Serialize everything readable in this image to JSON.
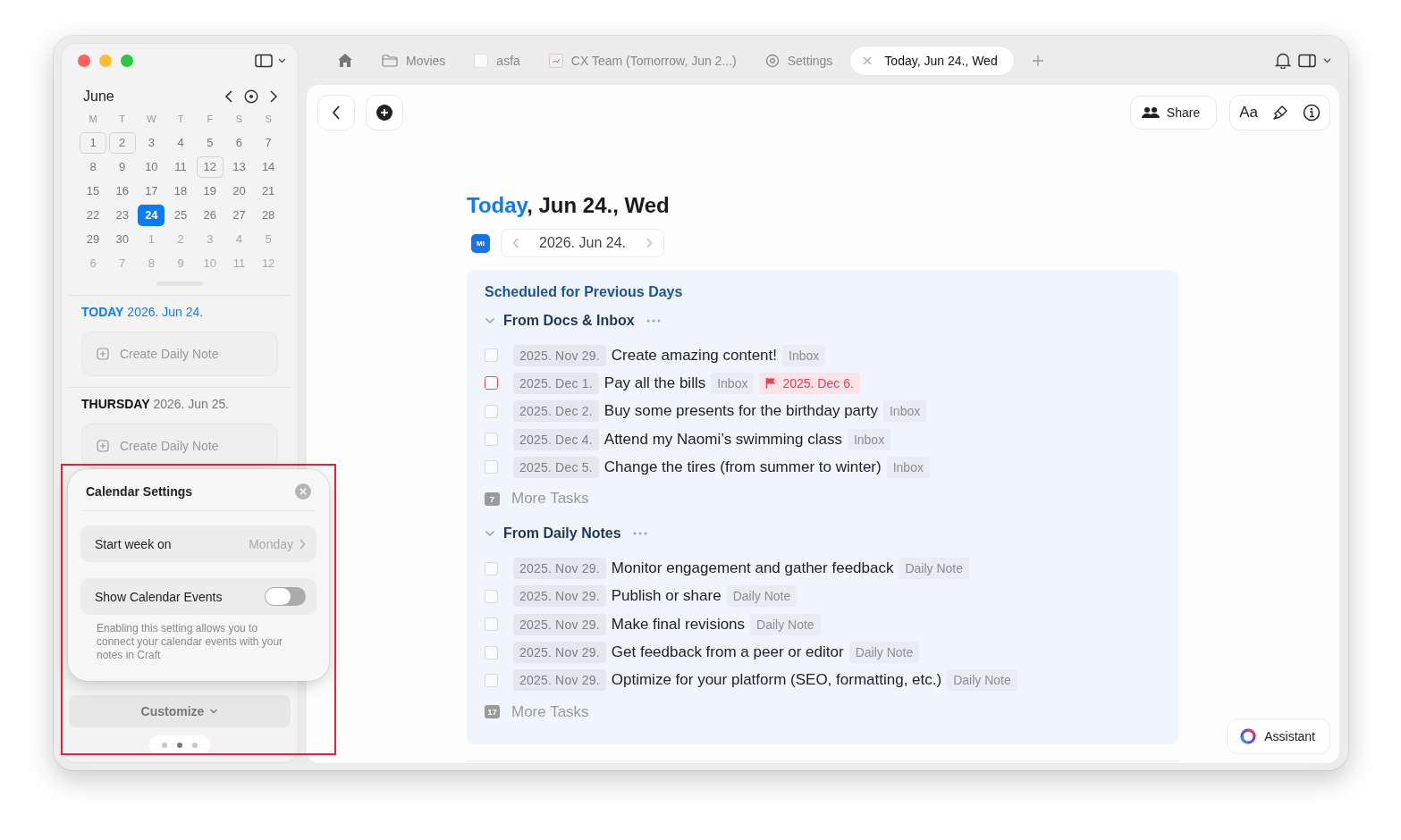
{
  "sidebar": {
    "month": "June",
    "weekdays": [
      "M",
      "T",
      "W",
      "T",
      "F",
      "S",
      "S"
    ],
    "weeks": [
      [
        {
          "label": "1",
          "marked": true,
          "selected": false,
          "other_month": false
        },
        {
          "label": "2",
          "marked": true,
          "selected": false,
          "other_month": false
        },
        {
          "label": "3",
          "marked": false,
          "selected": false,
          "other_month": false
        },
        {
          "label": "4",
          "marked": false,
          "selected": false,
          "other_month": false
        },
        {
          "label": "5",
          "marked": false,
          "selected": false,
          "other_month": false
        },
        {
          "label": "6",
          "marked": false,
          "selected": false,
          "other_month": false
        },
        {
          "label": "7",
          "marked": false,
          "selected": false,
          "other_month": false
        }
      ],
      [
        {
          "label": "8",
          "marked": false,
          "selected": false,
          "other_month": false
        },
        {
          "label": "9",
          "marked": false,
          "selected": false,
          "other_month": false
        },
        {
          "label": "10",
          "marked": false,
          "selected": false,
          "other_month": false
        },
        {
          "label": "11",
          "marked": false,
          "selected": false,
          "other_month": false
        },
        {
          "label": "12",
          "marked": true,
          "selected": false,
          "other_month": false
        },
        {
          "label": "13",
          "marked": false,
          "selected": false,
          "other_month": false
        },
        {
          "label": "14",
          "marked": false,
          "selected": false,
          "other_month": false
        }
      ],
      [
        {
          "label": "15",
          "marked": false,
          "selected": false,
          "other_month": false
        },
        {
          "label": "16",
          "marked": false,
          "selected": false,
          "other_month": false
        },
        {
          "label": "17",
          "marked": false,
          "selected": false,
          "other_month": false
        },
        {
          "label": "18",
          "marked": false,
          "selected": false,
          "other_month": false
        },
        {
          "label": "19",
          "marked": false,
          "selected": false,
          "other_month": false
        },
        {
          "label": "20",
          "marked": false,
          "selected": false,
          "other_month": false
        },
        {
          "label": "21",
          "marked": false,
          "selected": false,
          "other_month": false
        }
      ],
      [
        {
          "label": "22",
          "marked": false,
          "selected": false,
          "other_month": false
        },
        {
          "label": "23",
          "marked": false,
          "selected": false,
          "other_month": false
        },
        {
          "label": "24",
          "marked": false,
          "selected": true,
          "other_month": false
        },
        {
          "label": "25",
          "marked": false,
          "selected": false,
          "other_month": false
        },
        {
          "label": "26",
          "marked": false,
          "selected": false,
          "other_month": false
        },
        {
          "label": "27",
          "marked": false,
          "selected": false,
          "other_month": false
        },
        {
          "label": "28",
          "marked": false,
          "selected": false,
          "other_month": false
        }
      ],
      [
        {
          "label": "29",
          "marked": false,
          "selected": false,
          "other_month": false
        },
        {
          "label": "30",
          "marked": false,
          "selected": false,
          "other_month": false
        },
        {
          "label": "1",
          "marked": false,
          "selected": false,
          "other_month": true
        },
        {
          "label": "2",
          "marked": false,
          "selected": false,
          "other_month": true
        },
        {
          "label": "3",
          "marked": false,
          "selected": false,
          "other_month": true
        },
        {
          "label": "4",
          "marked": false,
          "selected": false,
          "other_month": true
        },
        {
          "label": "5",
          "marked": false,
          "selected": false,
          "other_month": true
        }
      ],
      [
        {
          "label": "6",
          "marked": false,
          "selected": false,
          "other_month": true
        },
        {
          "label": "7",
          "marked": false,
          "selected": false,
          "other_month": true
        },
        {
          "label": "8",
          "marked": false,
          "selected": false,
          "other_month": true
        },
        {
          "label": "9",
          "marked": false,
          "selected": false,
          "other_month": true
        },
        {
          "label": "10",
          "marked": false,
          "selected": false,
          "other_month": true
        },
        {
          "label": "11",
          "marked": false,
          "selected": false,
          "other_month": true
        },
        {
          "label": "12",
          "marked": false,
          "selected": false,
          "other_month": true
        }
      ]
    ],
    "days": [
      {
        "day": "TODAY",
        "date": "2026. Jun 24.",
        "today": true,
        "button": "Create Daily Note"
      },
      {
        "day": "THURSDAY",
        "date": "2026. Jun 25.",
        "today": false,
        "button": "Create Daily Note"
      }
    ],
    "customize": "Customize",
    "pages": [
      {
        "selected": false
      },
      {
        "selected": true
      },
      {
        "selected": false
      }
    ]
  },
  "settings_popup": {
    "title": "Calendar Settings",
    "start_week_label": "Start week on",
    "start_week_value": "Monday",
    "toggle_label": "Show Calendar Events",
    "toggle_on": false,
    "description": "Enabling this setting allows you to connect your calendar events with your notes in Craft"
  },
  "tabs": [
    {
      "kind": "home",
      "selected": false
    },
    {
      "kind": "folder",
      "label": "Movies",
      "selected": false
    },
    {
      "kind": "doc",
      "label": "asfa",
      "selected": false
    },
    {
      "kind": "chart",
      "label": "CX Team (Tomorrow, Jun 2...)",
      "selected": false
    },
    {
      "kind": "settings",
      "label": "Settings",
      "selected": false
    },
    {
      "label": "Today, Jun 24., Wed",
      "selected": true
    }
  ],
  "toolbar": {
    "share": "Share",
    "font": "Aa"
  },
  "page": {
    "title_highlight": "Today",
    "title_rest": ", Jun 24., Wed",
    "badge": "MI",
    "date": "2026. Jun 24.",
    "section_title": "Scheduled for Previous Days",
    "groups": [
      {
        "title": "From Docs & Inbox",
        "expanded": true,
        "tasks": [
          {
            "date": "2025. Nov 29.",
            "text": "Create amazing content!",
            "tag": "Inbox",
            "color": "#d4d7dc"
          },
          {
            "date": "2025. Dec 1.",
            "text": "Pay all the bills",
            "tag": "Inbox",
            "color": "#ee4a5c",
            "deadline": "2025. Dec 6."
          },
          {
            "date": "2025. Dec 2.",
            "text": "Buy some presents for the birthday party",
            "tag": "Inbox",
            "color": "#d4d7dc"
          },
          {
            "date": "2025. Dec 4.",
            "text": "Attend my Naomi’s swimming class",
            "tag": "Inbox",
            "color": "#d4d7dc"
          },
          {
            "date": "2025. Dec 5.",
            "text": "Change the tires (from summer to winter)",
            "tag": "Inbox",
            "color": "#d4d7dc"
          }
        ],
        "more_count": "7",
        "more_label": "More Tasks"
      },
      {
        "title": "From Daily Notes",
        "expanded": true,
        "tasks": [
          {
            "date": "2025. Nov 29.",
            "text": "Monitor engagement and gather feedback",
            "tag": "Daily Note",
            "color": "#d4d7dc"
          },
          {
            "date": "2025. Nov 29.",
            "text": "Publish or share",
            "tag": "Daily Note",
            "color": "#d4d7dc"
          },
          {
            "date": "2025. Nov 29.",
            "text": "Make final revisions",
            "tag": "Daily Note",
            "color": "#d4d7dc"
          },
          {
            "date": "2025. Nov 29.",
            "text": "Get feedback from a peer or editor",
            "tag": "Daily Note",
            "color": "#d4d7dc"
          },
          {
            "date": "2025. Nov 29.",
            "text": "Optimize for your platform (SEO, formatting, etc.)",
            "tag": "Daily Note",
            "color": "#d4d7dc"
          }
        ],
        "more_count": "17",
        "more_label": "More Tasks"
      }
    ]
  },
  "assistant": "Assistant"
}
